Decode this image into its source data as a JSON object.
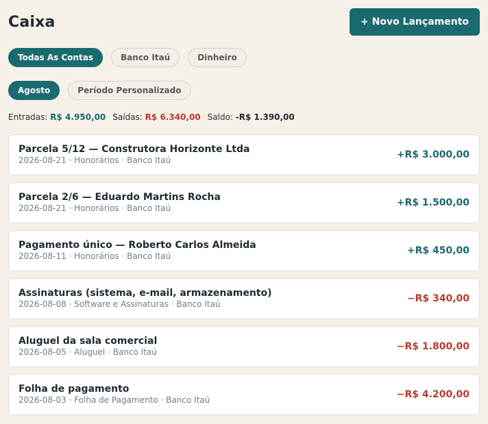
{
  "page": {
    "title": "Caixa",
    "new_button_label": "+ Novo Lançamento"
  },
  "filters": {
    "accounts": [
      {
        "label": "Todas As Contas",
        "active": true
      },
      {
        "label": "Banco Itaú",
        "active": false
      },
      {
        "label": "Dinheiro",
        "active": false
      }
    ],
    "periods": [
      {
        "label": "Agosto",
        "active": true
      },
      {
        "label": "Período Personalizado",
        "active": false
      }
    ]
  },
  "summary": {
    "income_label": "Entradas:",
    "income_value": "R$ 4.950,00",
    "expense_label": "Saídas:",
    "expense_value": "R$ 6.340,00",
    "balance_label": "Saldo:",
    "balance_value": "-R$ 1.390,00"
  },
  "transactions": [
    {
      "title": "Parcela 5/12 — Construtora Horizonte Ltda",
      "meta": "2026-08-21 · Honorários · Banco Itaú",
      "amount": "+R$ 3.000,00",
      "direction": "in"
    },
    {
      "title": "Parcela 2/6 — Eduardo Martins Rocha",
      "meta": "2026-08-21 · Honorários · Banco Itaú",
      "amount": "+R$ 1.500,00",
      "direction": "in"
    },
    {
      "title": "Pagamento único — Roberto Carlos Almeida",
      "meta": "2026-08-11 · Honorários · Banco Itaú",
      "amount": "+R$ 450,00",
      "direction": "in"
    },
    {
      "title": "Assinaturas (sistema, e-mail, armazenamento)",
      "meta": "2026-08-08 · Software e Assinaturas · Banco Itaú",
      "amount": "−R$ 340,00",
      "direction": "out"
    },
    {
      "title": "Aluguel da sala comercial",
      "meta": "2026-08-05 · Aluguel · Banco Itaú",
      "amount": "−R$ 1.800,00",
      "direction": "out"
    },
    {
      "title": "Folha de pagamento",
      "meta": "2026-08-03 · Folha de Pagamento · Banco Itaú",
      "amount": "−R$ 4.200,00",
      "direction": "out"
    }
  ],
  "colors": {
    "accent": "#1a6a6f",
    "negative": "#b83a2f",
    "background": "#f5f0e8"
  }
}
